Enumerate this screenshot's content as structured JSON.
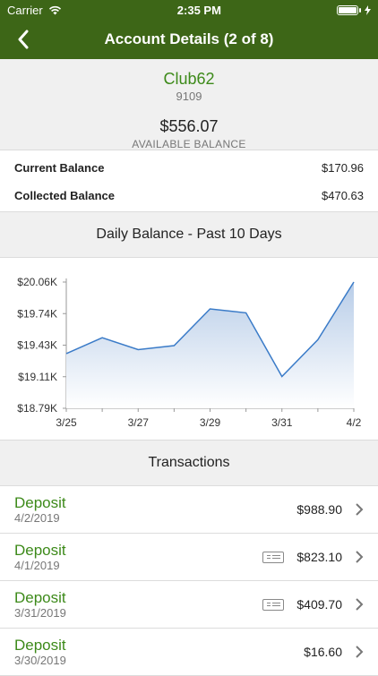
{
  "status": {
    "carrier": "Carrier",
    "time": "2:35 PM"
  },
  "nav": {
    "title": "Account Details (2 of 8)"
  },
  "account": {
    "name": "Club62",
    "number": "9109",
    "available_balance": "$556.07",
    "available_label": "AVAILABLE BALANCE"
  },
  "balances": [
    {
      "label": "Current Balance",
      "value": "$170.96"
    },
    {
      "label": "Collected Balance",
      "value": "$470.63"
    }
  ],
  "chart_section": {
    "title": "Daily Balance - Past 10 Days"
  },
  "chart_data": {
    "type": "area",
    "x": [
      "3/25",
      "3/26",
      "3/27",
      "3/28",
      "3/29",
      "3/30",
      "3/31",
      "4/1",
      "4/2"
    ],
    "values": [
      19.34,
      19.5,
      19.38,
      19.42,
      19.79,
      19.75,
      19.11,
      19.48,
      20.06
    ],
    "xticks": [
      "3/25",
      "3/27",
      "3/29",
      "3/31",
      "4/2"
    ],
    "yticks": [
      "$18.79K",
      "$19.11K",
      "$19.43K",
      "$19.74K",
      "$20.06K"
    ],
    "ylim": [
      18.79,
      20.06
    ],
    "colors": {
      "line": "#3a7bc8",
      "fill_top": "#b8cde8",
      "fill_bottom": "#ffffff"
    }
  },
  "transactions_section": {
    "title": "Transactions"
  },
  "transactions": [
    {
      "title": "Deposit",
      "date": "4/2/2019",
      "amount": "$988.90",
      "check": false
    },
    {
      "title": "Deposit",
      "date": "4/1/2019",
      "amount": "$823.10",
      "check": true
    },
    {
      "title": "Deposit",
      "date": "3/31/2019",
      "amount": "$409.70",
      "check": true
    },
    {
      "title": "Deposit",
      "date": "3/30/2019",
      "amount": "$16.60",
      "check": false
    }
  ]
}
